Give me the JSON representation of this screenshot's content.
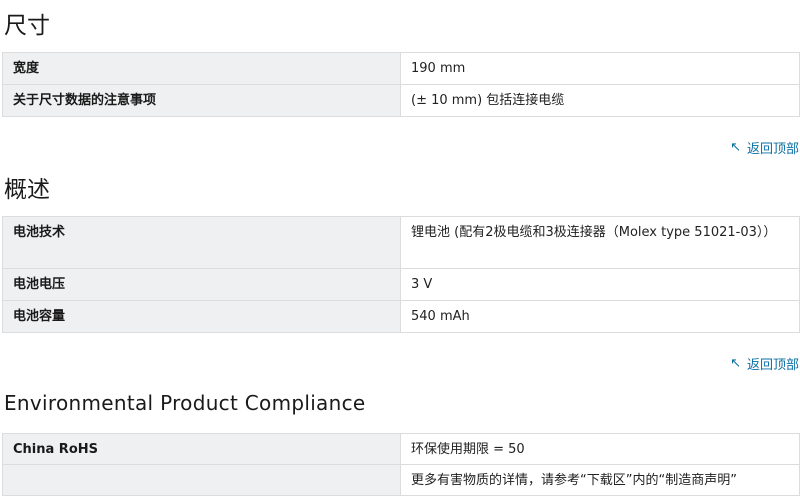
{
  "sections": [
    {
      "title": "尺寸",
      "rows": [
        {
          "key": "宽度",
          "value": "190 mm"
        },
        {
          "key": "关于尺寸数据的注意事项",
          "value": "(± 10 mm) 包括连接电缆"
        }
      ],
      "back_to_top": "返回顶部"
    },
    {
      "title": "概述",
      "rows": [
        {
          "key": "电池技术",
          "value": "锂电池 (配有2极电缆和3极连接器（Molex type 51021-03））"
        },
        {
          "key": "电池电压",
          "value": "3 V"
        },
        {
          "key": "电池容量",
          "value": "540 mAh"
        }
      ],
      "back_to_top": "返回顶部"
    },
    {
      "title": "Environmental Product Compliance",
      "rows": [
        {
          "key": "China RoHS",
          "value": "环保使用期限 = 50"
        },
        {
          "key": "",
          "value": "更多有害物质的详情，请参考“下载区”内的“制造商声明”"
        }
      ]
    }
  ],
  "icons": {
    "back_to_top": "arrow-up-left-icon"
  },
  "colors": {
    "link": "#0b6fa4",
    "key_bg": "#eef0f1",
    "border": "#dcdcdc"
  }
}
